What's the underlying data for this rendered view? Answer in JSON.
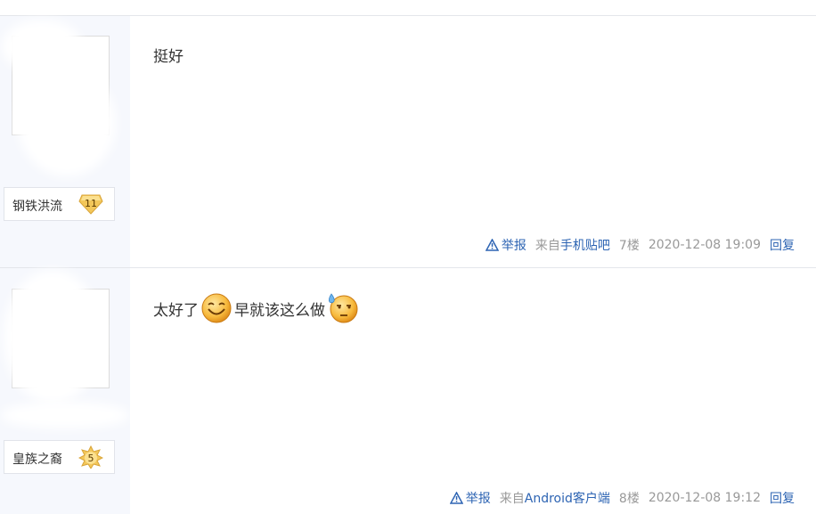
{
  "posts": [
    {
      "user": {
        "name": "钢铁洪流",
        "level": "11"
      },
      "content": {
        "text": "挺好"
      },
      "meta": {
        "report_label": "举报",
        "source_prefix": "来自",
        "source_link": "手机贴吧",
        "floor": "7楼",
        "time": "2020-12-08 19:09",
        "reply_label": "回复"
      }
    },
    {
      "user": {
        "name": "皇族之裔",
        "level": "5"
      },
      "content": {
        "text_1": "太好了",
        "emoji_1": "smile-emoji",
        "text_2": "早就该这么做",
        "emoji_2": "sweat-emoji"
      },
      "meta": {
        "report_label": "举报",
        "source_prefix": "来自",
        "source_link": "Android客户端",
        "floor": "8楼",
        "time": "2020-12-08 19:12",
        "reply_label": "回复"
      }
    }
  ],
  "colors": {
    "link": "#2d64b3",
    "meta_gray": "#999999",
    "sidebar_bg": "#f6f8fd",
    "badge_gold": "#f3c75a"
  }
}
